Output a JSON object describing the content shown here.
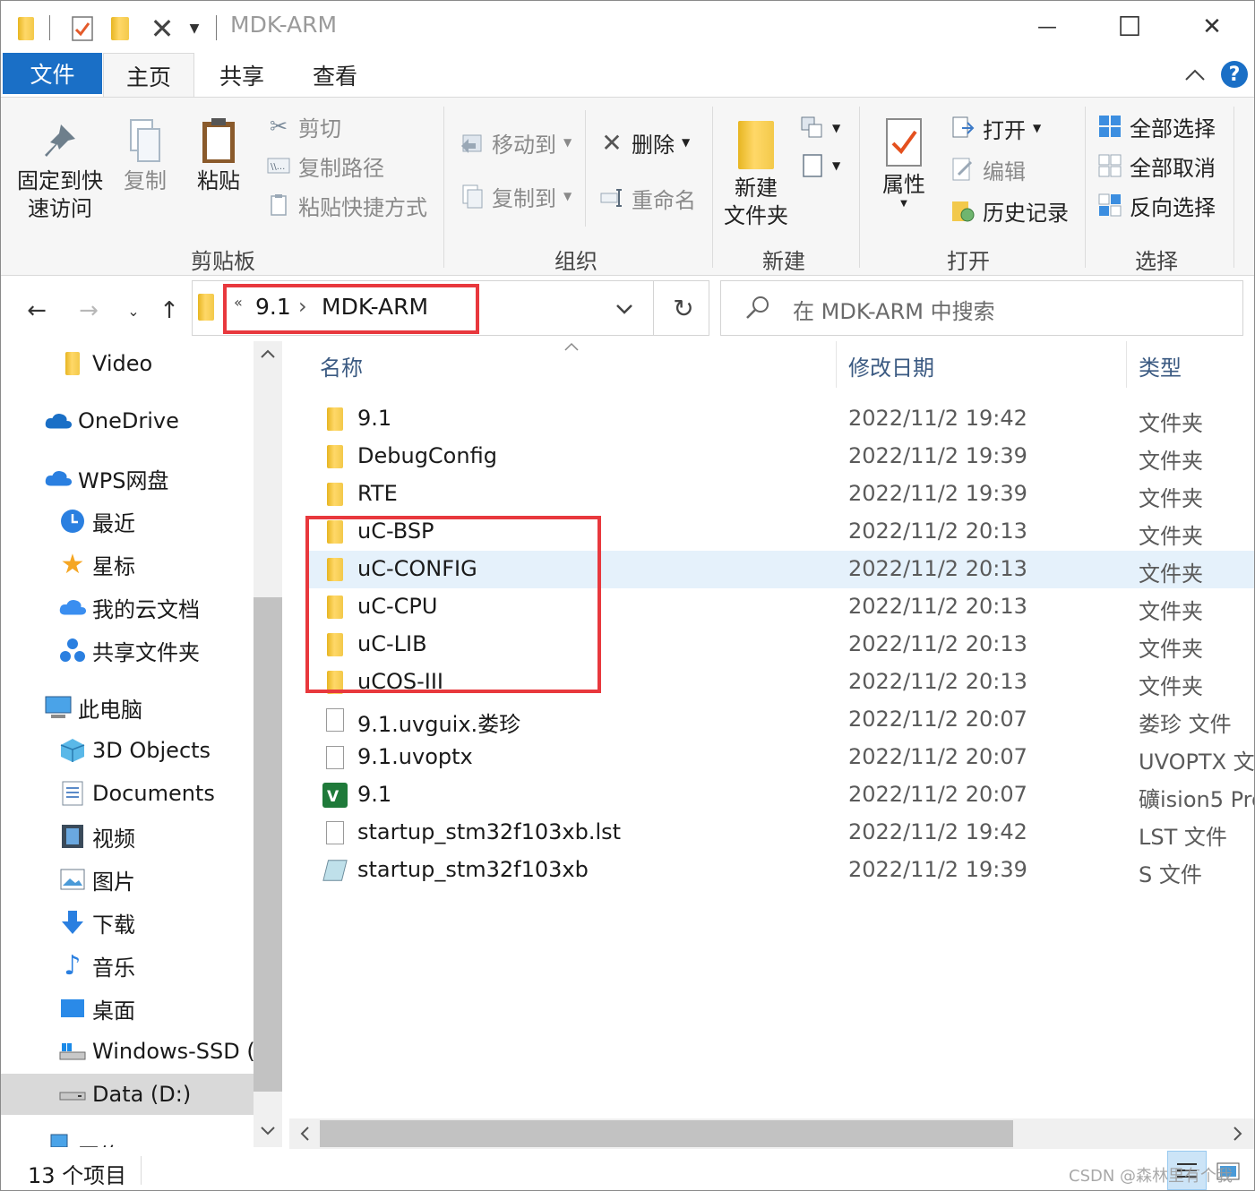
{
  "window": {
    "title": "MDK-ARM",
    "minimize_glyph": "—",
    "maximize_glyph": "☐",
    "close_glyph": "✕"
  },
  "ribbon_tabs": {
    "file": "文件",
    "home": "主页",
    "share": "共享",
    "view": "查看"
  },
  "ribbon": {
    "clipboard": {
      "label": "剪贴板",
      "pin_line1": "固定到快",
      "pin_line2": "速访问",
      "copy": "复制",
      "paste": "粘贴",
      "cut": "剪切",
      "copy_path": "复制路径",
      "paste_shortcut": "粘贴快捷方式"
    },
    "organize": {
      "label": "组织",
      "move_to": "移动到",
      "copy_to": "复制到",
      "delete": "删除",
      "rename": "重命名"
    },
    "new": {
      "label": "新建",
      "new_folder_line1": "新建",
      "new_folder_line2": "文件夹"
    },
    "open": {
      "label": "打开",
      "properties": "属性",
      "open": "打开",
      "edit": "编辑",
      "history": "历史记录"
    },
    "select": {
      "label": "选择",
      "select_all": "全部选择",
      "select_none": "全部取消",
      "invert": "反向选择"
    }
  },
  "address": {
    "overflow": "«",
    "crumb1": "9.1",
    "crumb2": "MDK-ARM",
    "separator": "›"
  },
  "search": {
    "placeholder": "在 MDK-ARM 中搜索"
  },
  "nav_pane": [
    {
      "label": "Video",
      "icon": "folder-icon"
    },
    {
      "label": "OneDrive",
      "icon": "cloud-icon"
    },
    {
      "label": "WPS网盘",
      "icon": "cloud-icon"
    },
    {
      "label": "最近",
      "icon": "clock-icon"
    },
    {
      "label": "星标",
      "icon": "star-icon"
    },
    {
      "label": "我的云文档",
      "icon": "cloud-icon"
    },
    {
      "label": "共享文件夹",
      "icon": "share-icon"
    },
    {
      "label": "此电脑",
      "icon": "computer-icon"
    },
    {
      "label": "3D Objects",
      "icon": "cube-icon"
    },
    {
      "label": "Documents",
      "icon": "document-icon"
    },
    {
      "label": "视频",
      "icon": "film-icon"
    },
    {
      "label": "图片",
      "icon": "picture-icon"
    },
    {
      "label": "下载",
      "icon": "download-icon"
    },
    {
      "label": "音乐",
      "icon": "music-icon"
    },
    {
      "label": "桌面",
      "icon": "desktop-icon"
    },
    {
      "label": "Windows-SSD (",
      "icon": "drive-icon"
    },
    {
      "label": "Data (D:)",
      "icon": "drive-icon"
    },
    {
      "label": "网络",
      "icon": "network-icon"
    }
  ],
  "columns": {
    "name": "名称",
    "date": "修改日期",
    "type": "类型"
  },
  "files": [
    {
      "name": "9.1",
      "date": "2022/11/2 19:42",
      "type": "文件夹",
      "icon": "folder-icon"
    },
    {
      "name": "DebugConfig",
      "date": "2022/11/2 19:39",
      "type": "文件夹",
      "icon": "folder-icon"
    },
    {
      "name": "RTE",
      "date": "2022/11/2 19:39",
      "type": "文件夹",
      "icon": "folder-icon"
    },
    {
      "name": "uC-BSP",
      "date": "2022/11/2 20:13",
      "type": "文件夹",
      "icon": "folder-icon"
    },
    {
      "name": "uC-CONFIG",
      "date": "2022/11/2 20:13",
      "type": "文件夹",
      "icon": "folder-icon"
    },
    {
      "name": "uC-CPU",
      "date": "2022/11/2 20:13",
      "type": "文件夹",
      "icon": "folder-icon"
    },
    {
      "name": "uC-LIB",
      "date": "2022/11/2 20:13",
      "type": "文件夹",
      "icon": "folder-icon"
    },
    {
      "name": "uCOS-III",
      "date": "2022/11/2 20:13",
      "type": "文件夹",
      "icon": "folder-icon"
    },
    {
      "name": "9.1.uvguix.娄珍",
      "date": "2022/11/2 20:07",
      "type": "娄珍 文件",
      "icon": "file-icon"
    },
    {
      "name": "9.1.uvoptx",
      "date": "2022/11/2 20:07",
      "type": "UVOPTX 文",
      "icon": "file-icon"
    },
    {
      "name": "9.1",
      "date": "2022/11/2 20:07",
      "type": "礦ision5 Pro",
      "icon": "keil-project-icon"
    },
    {
      "name": "startup_stm32f103xb.lst",
      "date": "2022/11/2 19:42",
      "type": "LST 文件",
      "icon": "file-icon"
    },
    {
      "name": "startup_stm32f103xb",
      "date": "2022/11/2 19:39",
      "type": "S 文件",
      "icon": "asm-file-icon"
    }
  ],
  "status": {
    "count": "13 个项目"
  },
  "watermark": "CSDN @森林里有个我",
  "colors": {
    "accent": "#1a6fc6",
    "highlight_box": "#e8383d",
    "selected_row": "#e5f1fb"
  }
}
